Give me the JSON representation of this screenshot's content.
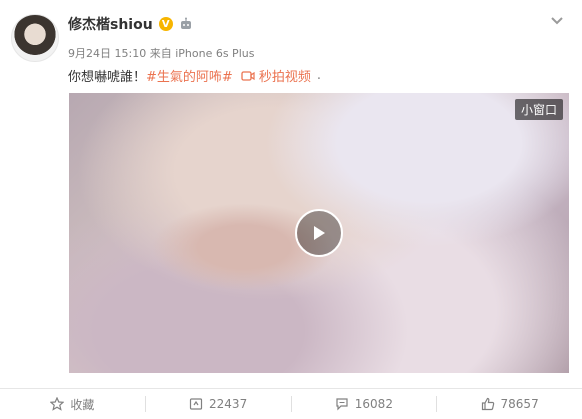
{
  "post": {
    "username": "修杰楷shiou",
    "verified_badge": "V",
    "date": "9月24日 15:10",
    "via_label": "来自",
    "device": "iPhone 6s Plus",
    "text_before": "你想嚇唬誰！",
    "hashtag": "#生氣的阿咘#",
    "video_link": "秒拍视频",
    "text_after": "."
  },
  "video": {
    "mini_window_label": "小窗口"
  },
  "actions": {
    "favorite_label": "收藏",
    "repost_count": "22437",
    "comment_count": "16082",
    "like_count": "78657"
  },
  "colors": {
    "link": "#eb7350",
    "badge": "#f7b500",
    "muted": "#808080"
  },
  "icons": [
    "avatar",
    "verified-badge",
    "robot-icon",
    "chevron-down-icon",
    "video-camera-icon",
    "play-icon",
    "star-icon",
    "repost-icon",
    "comment-icon",
    "thumbs-up-icon"
  ]
}
